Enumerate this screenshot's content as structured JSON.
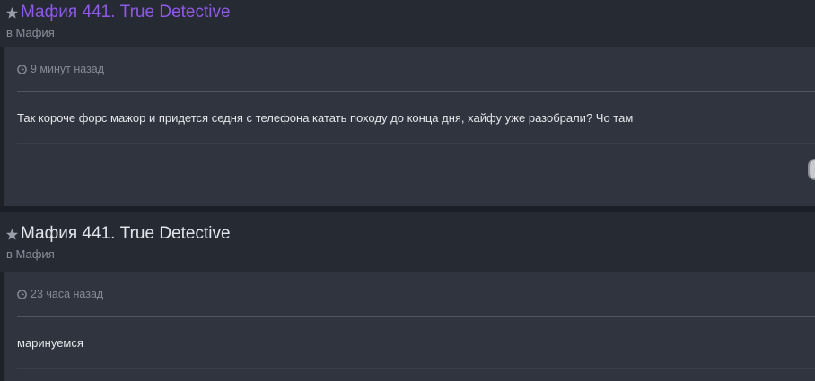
{
  "entries": [
    {
      "title": "Мафия 441. True Detective",
      "forum_prefix": "в",
      "forum_name": "Мафия",
      "time": "9 минут назад",
      "text": "Так короче форс мажор и придется седня с телефона катать походу до конца дня, хайфу уже разобрали? Чо там",
      "title_color": "#8f59e8"
    },
    {
      "title": "Мафия 441. True Detective",
      "forum_prefix": "в",
      "forum_name": "Мафия",
      "time": "23 часа назад",
      "text": "маринуемся",
      "title_color": "#e3e5ea"
    }
  ],
  "icons": {
    "star": "star-icon",
    "clock": "clock-icon"
  }
}
